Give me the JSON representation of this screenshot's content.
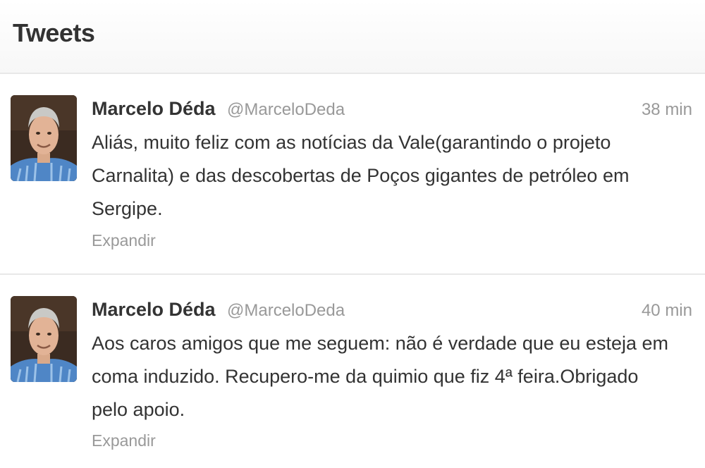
{
  "header": {
    "title": "Tweets"
  },
  "tweets": [
    {
      "name": "Marcelo Déda",
      "handle": "@MarceloDeda",
      "time": "38 min",
      "text": "Aliás, muito feliz com as notícias da Vale(garantindo o projeto Carnalita) e das descobertas de Poços gigantes de petróleo em Sergipe.",
      "expand": "Expandir"
    },
    {
      "name": "Marcelo Déda",
      "handle": "@MarceloDeda",
      "time": "40 min",
      "text": "Aos caros amigos que me seguem: não é verdade que eu esteja em coma induzido. Recupero-me da quimio que fiz 4ª feira.Obrigado pelo apoio.",
      "expand": "Expandir"
    }
  ],
  "colors": {
    "text": "#333333",
    "muted": "#999999",
    "divider": "#e8e8e8"
  }
}
